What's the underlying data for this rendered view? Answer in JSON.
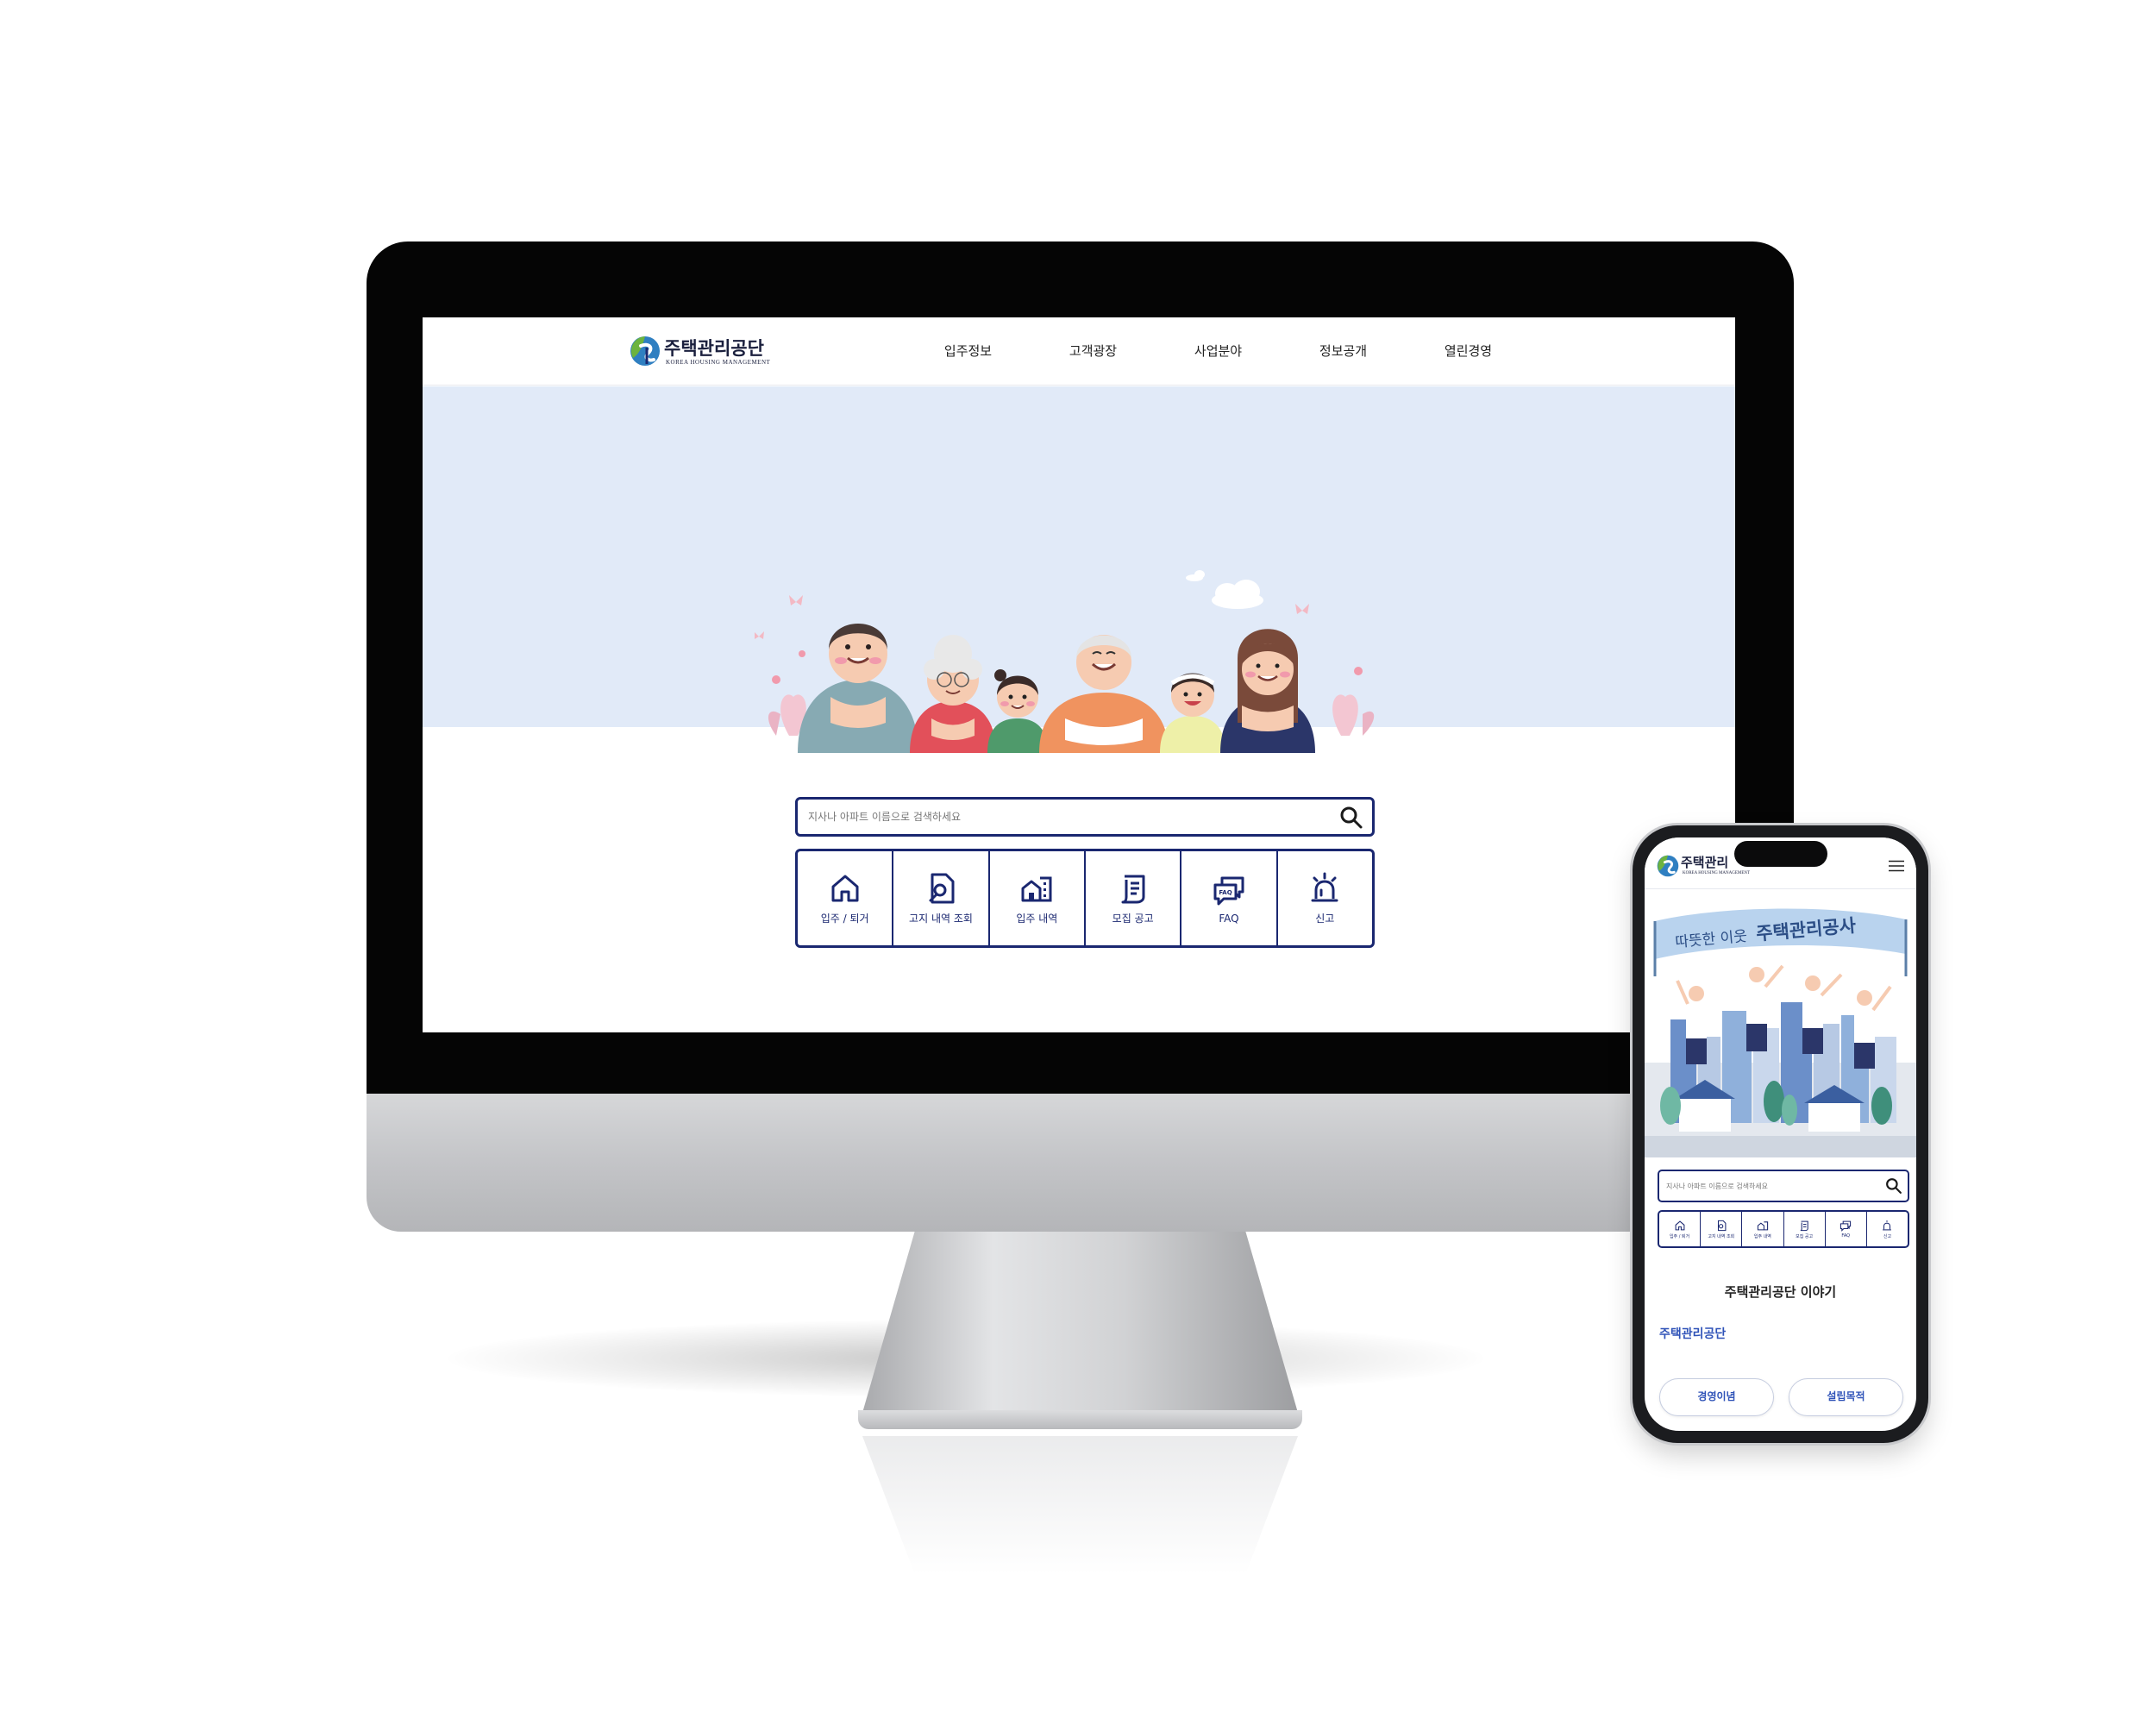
{
  "brand": {
    "name": "주택관리공단",
    "subtitle": "KOREA HOUSING MANAGEMENT",
    "primary_color": "#1a2770",
    "hero_color": "#e1eaf8"
  },
  "desktop": {
    "nav": [
      "입주정보",
      "고객광장",
      "사업분야",
      "정보공개",
      "열린경영"
    ],
    "search": {
      "placeholder": "지사나 아파트 이름으로 검색하세요"
    },
    "quick_links": [
      {
        "label": "입주 / 퇴거",
        "icon": "house-icon"
      },
      {
        "label": "고지 내역 조회",
        "icon": "document-search-icon"
      },
      {
        "label": "입주 내역",
        "icon": "buildings-icon"
      },
      {
        "label": "모집 공고",
        "icon": "notice-scroll-icon"
      },
      {
        "label": "FAQ",
        "icon": "faq-chat-icon"
      },
      {
        "label": "신고",
        "icon": "siren-icon"
      }
    ],
    "faq_icon_text": "FAQ"
  },
  "mobile": {
    "logo_title": "주택관리",
    "banner": {
      "prefix": "따뜻한 이웃",
      "highlight": "주택관리공사"
    },
    "search": {
      "placeholder": "지사나 아파트 이름으로 검색하세요"
    },
    "quick_links": [
      {
        "label": "입주 / 퇴거",
        "icon": "house-icon"
      },
      {
        "label": "고지 내역 조회",
        "icon": "document-search-icon"
      },
      {
        "label": "입주 내역",
        "icon": "buildings-icon"
      },
      {
        "label": "모집 공고",
        "icon": "notice-scroll-icon"
      },
      {
        "label": "FAQ",
        "icon": "faq-chat-icon"
      },
      {
        "label": "신고",
        "icon": "siren-icon"
      }
    ],
    "section_title": "주택관리공단 이야기",
    "section_subtitle": "주택관리공단",
    "pills": [
      "경영이념",
      "설립목적"
    ]
  }
}
